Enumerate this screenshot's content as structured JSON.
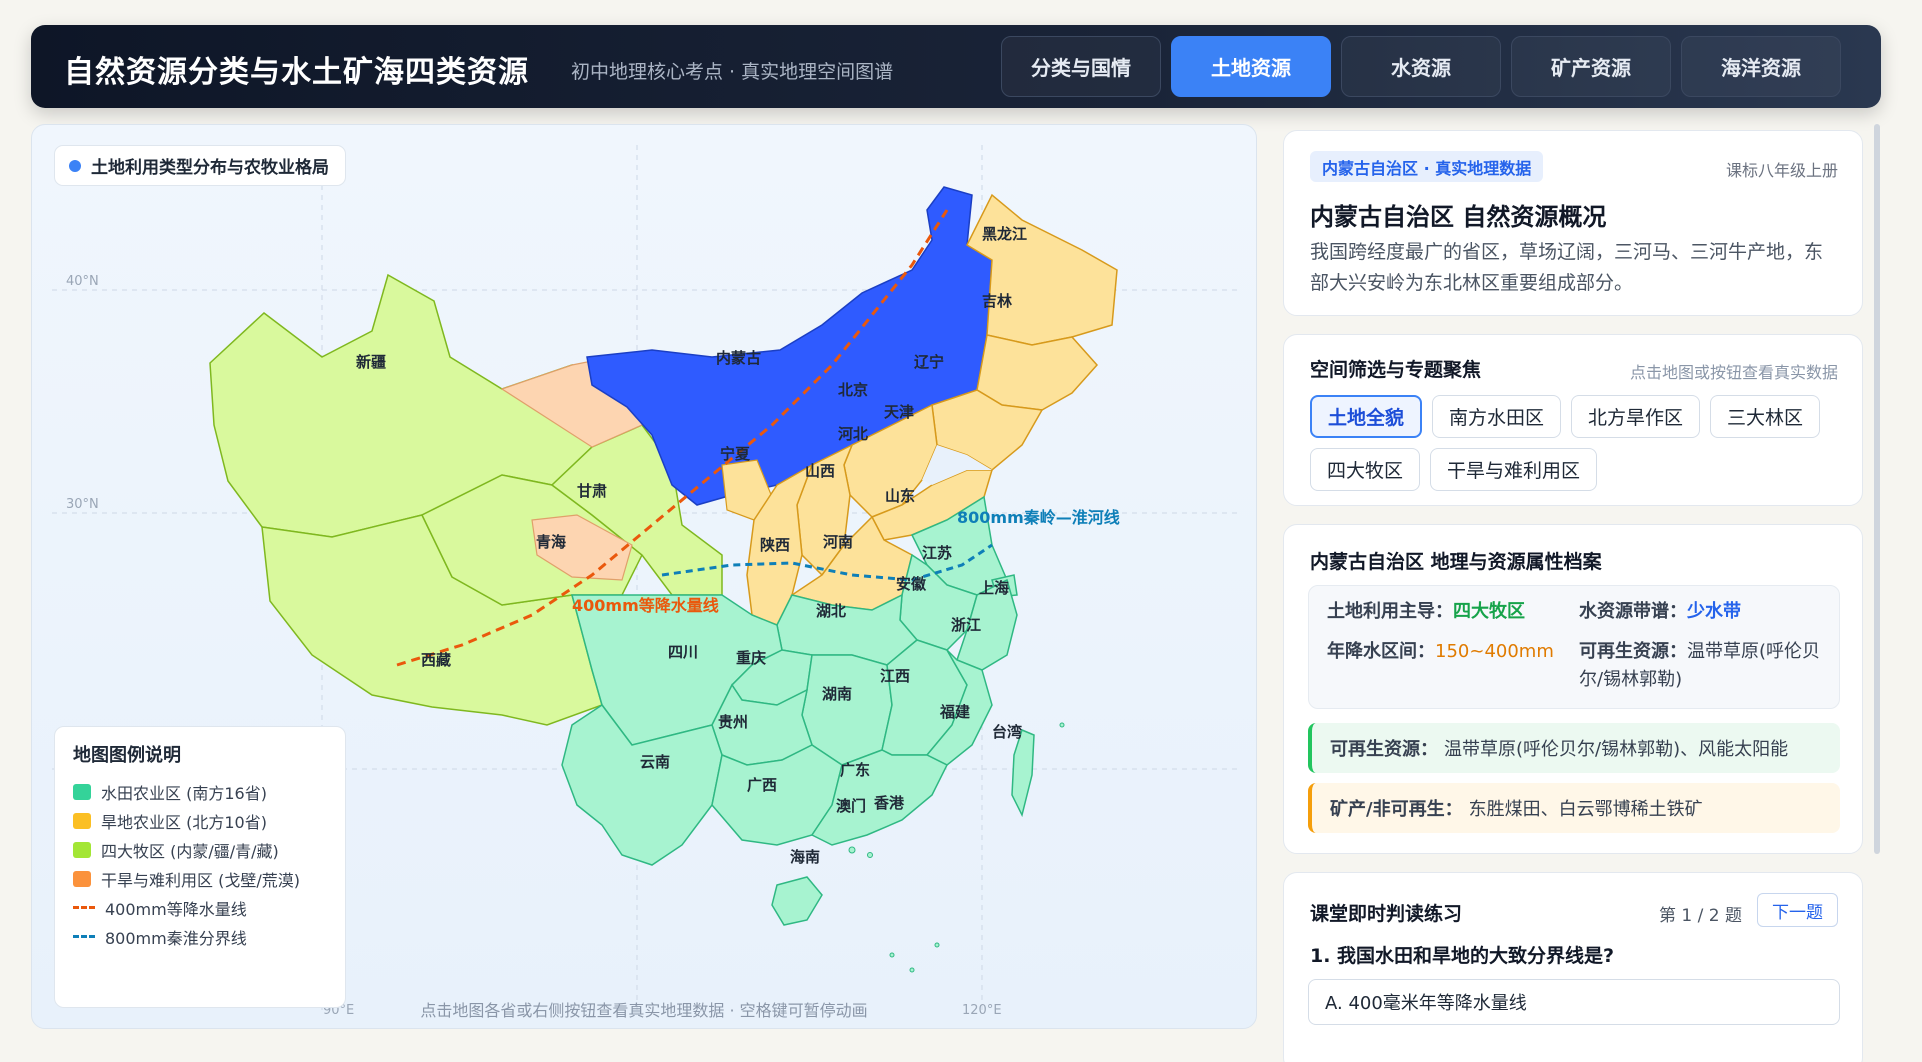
{
  "header": {
    "title": "自然资源分类与水土矿海四类资源",
    "subtitle": "初中地理核心考点 · 真实地理空间图谱",
    "tabs": [
      {
        "label": "分类与国情",
        "active": false
      },
      {
        "label": "土地资源",
        "active": true
      },
      {
        "label": "水资源",
        "active": false
      },
      {
        "label": "矿产资源",
        "active": false
      },
      {
        "label": "海洋资源",
        "active": false
      }
    ]
  },
  "map": {
    "chip_label": "土地利用类型分布与农牧业格局",
    "lat_labels": [
      "40°N",
      "30°N"
    ],
    "lon_labels": [
      "90°E",
      "120°E"
    ],
    "line_400": "400mm等降水量线",
    "line_800": "800mm秦岭—淮河线",
    "provinces": [
      "新疆",
      "西藏",
      "青海",
      "甘肃",
      "内蒙古",
      "宁夏",
      "陕西",
      "山西",
      "河北",
      "北京",
      "天津",
      "辽宁",
      "吉林",
      "黑龙江",
      "山东",
      "河南",
      "江苏",
      "安徽",
      "上海",
      "浙江",
      "湖北",
      "四川",
      "重庆",
      "湖南",
      "江西",
      "福建",
      "台湾",
      "贵州",
      "云南",
      "广西",
      "广东",
      "香港",
      "澳门",
      "海南"
    ],
    "legend": {
      "title": "地图图例说明",
      "items": [
        {
          "label": "水田农业区 (南方16省)",
          "color": "#34d399"
        },
        {
          "label": "旱地农业区 (北方10省)",
          "color": "#fbbf24"
        },
        {
          "label": "四大牧区 (内蒙/疆/青/藏)",
          "color": "#a3e635"
        },
        {
          "label": "干旱与难利用区 (戈壁/荒漠)",
          "color": "#fb923c"
        },
        {
          "label": "400mm等降水量线",
          "color": "#ea580c"
        },
        {
          "label": "800mm秦淮分界线",
          "color": "#0e7fb8"
        }
      ]
    },
    "hint": "点击地图各省或右侧按钮查看真实地理数据 · 空格键可暂停动画"
  },
  "overview": {
    "tag": "内蒙古自治区 · 真实地理数据",
    "grade": "课标八年级上册",
    "title": "内蒙古自治区 自然资源概况",
    "desc": "我国跨经度最广的省区，草场辽阔，三河马、三河牛产地，东部大兴安岭为东北林区重要组成部分。"
  },
  "filter": {
    "title": "空间筛选与专题聚焦",
    "note": "点击地图或按钮查看真实数据",
    "chips": [
      {
        "label": "土地全貌",
        "active": true
      },
      {
        "label": "南方水田区",
        "active": false
      },
      {
        "label": "北方旱作区",
        "active": false
      },
      {
        "label": "三大林区",
        "active": false
      },
      {
        "label": "四大牧区",
        "active": false
      },
      {
        "label": "干旱与难利用区",
        "active": false
      }
    ]
  },
  "profile": {
    "title": "内蒙古自治区 地理与资源属性档案",
    "land_use_key": "土地利用主导：",
    "land_use_val": "四大牧区",
    "water_key": "水资源带谱：",
    "water_val": "少水带",
    "rain_key": "年降水区间：",
    "rain_val": "150~400mm",
    "renew_key": "可再生资源：",
    "renew_val": "温带草原(呼伦贝尔/锡林郭勒)",
    "renew_bar_key": "可再生资源：",
    "renew_bar_val": "温带草原(呼伦贝尔/锡林郭勒)、风能太阳能",
    "mineral_key": "矿产/非可再生：",
    "mineral_val": "东胜煤田、白云鄂博稀土铁矿"
  },
  "quiz": {
    "title": "课堂即时判读练习",
    "counter": "第 1 / 2 题",
    "next": "下一题",
    "question": "1. 我国水田和旱地的大致分界线是?",
    "option_a": "A. 400毫米年等降水量线"
  },
  "colors": {
    "paddy": "#a7f3d0",
    "dry": "#fde29a",
    "pasture": "#d9f99d",
    "arid": "#fdd5b1",
    "highlight": "#2f5bff",
    "accent": "#3b82f6"
  }
}
